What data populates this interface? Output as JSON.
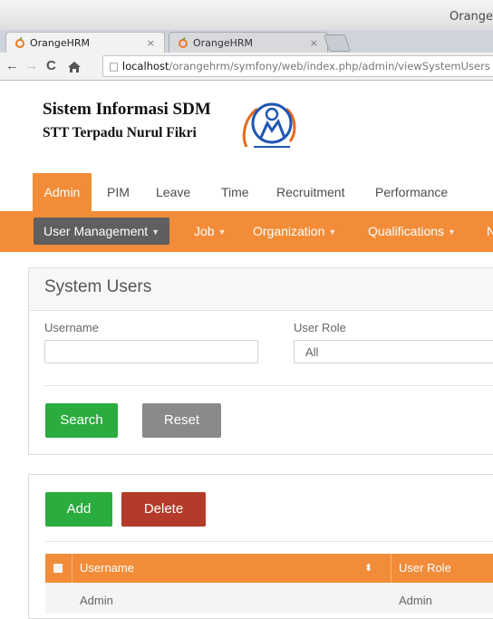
{
  "browser": {
    "window_title": "Orange",
    "tabs": [
      {
        "label": "OrangeHRM",
        "close": "×"
      },
      {
        "label": "OrangeHRM",
        "close": "×"
      }
    ],
    "url_host": "localhost",
    "url_path": "/orangehrm/symfony/web/index.php/admin/viewSystemUsers"
  },
  "header": {
    "line1": "Sistem Informasi SDM",
    "line2": "STT Terpadu Nurul Fikri"
  },
  "main_menu": [
    {
      "label": "Admin",
      "active": true
    },
    {
      "label": "PIM"
    },
    {
      "label": "Leave"
    },
    {
      "label": "Time"
    },
    {
      "label": "Recruitment"
    },
    {
      "label": "Performance"
    }
  ],
  "sub_menu": [
    {
      "label": "User Management",
      "active": true
    },
    {
      "label": "Job"
    },
    {
      "label": "Organization"
    },
    {
      "label": "Qualifications"
    },
    {
      "label": "N"
    }
  ],
  "search_panel": {
    "title": "System Users",
    "username_label": "Username",
    "username_value": "",
    "user_role_label": "User Role",
    "user_role_value": "All",
    "search_button": "Search",
    "reset_button": "Reset"
  },
  "list_panel": {
    "add_button": "Add",
    "delete_button": "Delete",
    "columns": [
      "Username",
      "User Role"
    ],
    "sort_indicator": "⬍",
    "rows": [
      {
        "username": "Admin",
        "user_role": "Admin"
      }
    ]
  },
  "colors": {
    "accent_orange": "#f28c38",
    "active_submenu": "#5f5f5f",
    "search_green": "#2bac3e",
    "reset_gray": "#8a8a8a",
    "delete_red": "#b43b2b"
  },
  "icons": {
    "tab_favicon": "orangehrm-favicon",
    "back": "arrow-left-icon",
    "forward": "arrow-right-icon",
    "reload": "reload-icon",
    "home": "home-icon",
    "page": "page-icon"
  }
}
